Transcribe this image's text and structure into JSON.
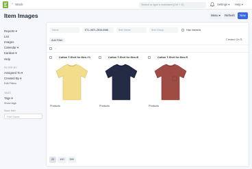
{
  "navbar": {
    "breadcrumb_separator": "›",
    "breadcrumb": "Stock",
    "search_placeholder": "Search or type a command (Ctrl + G)",
    "settings": "Settings ▾",
    "help": "Help ▾"
  },
  "page": {
    "title": "Item Images",
    "menu_label": "Menu ▾",
    "refresh_label": "Refresh",
    "new_label": "New"
  },
  "sidebar": {
    "items": [
      "Reports ▾",
      "List",
      "Images",
      "Calendar ▾",
      "Kanban ▾",
      "Help"
    ],
    "filter_heading": "FILTER BY",
    "assigned_to": "Assigned To ▾",
    "created_by": "Created By ▾",
    "edit_filters": "Edit Filters",
    "tags_heading": "TAGS",
    "tags": "Tags ▾",
    "show_tags": "Show tags",
    "save_filter_label": "Save filter",
    "filter_name_placeholder": "Filter Name"
  },
  "filters": {
    "name_placeholder": "Name",
    "item_code_value": "ETL-4671-2816-0088",
    "item_name_placeholder": "Item Name",
    "item_group_placeholder": "Item Group",
    "has_variants_label": "Has Variants",
    "add_filter_label": "Add Filter",
    "sort_label": "Created On ⇅",
    "star_glyph": "☆"
  },
  "cards": [
    {
      "title": "Cotton T-Shirt for Men-Y1",
      "group": "Products",
      "shirt_color": "#f1dd8b"
    },
    {
      "title": "Cotton T-Shirt for Men-B",
      "group": "Products",
      "shirt_color": "#232b45"
    },
    {
      "title": "Cotton T-Shirt for Men-R",
      "group": "Products",
      "shirt_color": "#9e4c44"
    }
  ],
  "pager": {
    "options": [
      "20",
      "100",
      "500"
    ],
    "active": "20"
  },
  "colors": {
    "primary": "#3b69e1"
  }
}
